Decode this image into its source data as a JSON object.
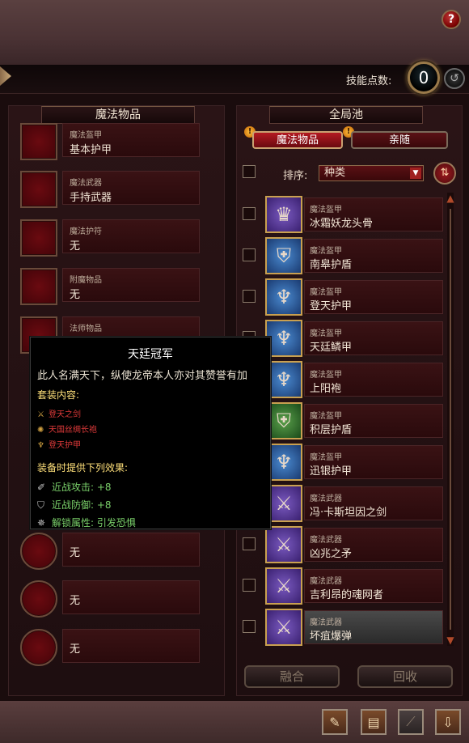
{
  "skill": {
    "label": "技能点数:",
    "points": "0"
  },
  "help_label": "?",
  "left_panel": {
    "title": "魔法物品",
    "square_slots": [
      {
        "category": "魔法盔甲",
        "value": "基本护甲"
      },
      {
        "category": "魔法武器",
        "value": "手持武器"
      },
      {
        "category": "魔法护符",
        "value": "无"
      },
      {
        "category": "附魔物品",
        "value": "无"
      },
      {
        "category": "法师物品",
        "value": ""
      }
    ],
    "round_slots": [
      {
        "value": "无"
      },
      {
        "value": "无"
      },
      {
        "value": "无"
      }
    ]
  },
  "right_panel": {
    "title": "全局池",
    "tabs": [
      "魔法物品",
      "亲随"
    ],
    "sort_label": "排序:",
    "sort_value": "种类",
    "items": [
      {
        "category": "魔法盔甲",
        "name": "冰霜妖龙头骨",
        "color": "purple",
        "icon": "helmet-icon"
      },
      {
        "category": "魔法盔甲",
        "name": "南皋护盾",
        "color": "blue",
        "icon": "shield-icon"
      },
      {
        "category": "魔法盔甲",
        "name": "登天护甲",
        "color": "blue",
        "icon": "armor-icon"
      },
      {
        "category": "魔法盔甲",
        "name": "天廷鳞甲",
        "color": "blue",
        "icon": "armor-icon"
      },
      {
        "category": "魔法盔甲",
        "name": "上阳袍",
        "color": "blue",
        "icon": "armor-icon"
      },
      {
        "category": "魔法盔甲",
        "name": "积层护盾",
        "color": "green",
        "icon": "shield-icon"
      },
      {
        "category": "魔法盔甲",
        "name": "迅银护甲",
        "color": "blue",
        "icon": "armor-icon"
      },
      {
        "category": "魔法武器",
        "name": "冯·卡斯坦因之剑",
        "color": "purple",
        "icon": "crossed-weapons-icon"
      },
      {
        "category": "魔法武器",
        "name": "凶兆之矛",
        "color": "purple",
        "icon": "crossed-weapons-icon"
      },
      {
        "category": "魔法武器",
        "name": "吉利昂的魂网者",
        "color": "purple",
        "icon": "crossed-weapons-icon"
      },
      {
        "category": "魔法武器",
        "name": "坏疽爆弹",
        "color": "purple",
        "icon": "crossed-weapons-icon"
      }
    ],
    "buttons": {
      "fuse": "融合",
      "recycle": "回收"
    }
  },
  "tooltip": {
    "title": "天廷冠军",
    "description": "此人名满天下，纵使龙帝本人亦对其赞誉有加",
    "set_header": "套装内容:",
    "set_items": [
      "登天之剑",
      "天国丝绸长袍",
      "登天护甲"
    ],
    "effects_header": "装备时提供下列效果:",
    "effects": [
      "近战攻击: +8",
      "近战防御: +8",
      "解锁属性: 引发恐惧"
    ]
  },
  "colors": {
    "accent_red": "#b41a22",
    "gold_border": "#c9a050",
    "effect_green": "#7ad06a",
    "set_red": "#e03a3a",
    "header_yellow": "#ffe07a"
  }
}
